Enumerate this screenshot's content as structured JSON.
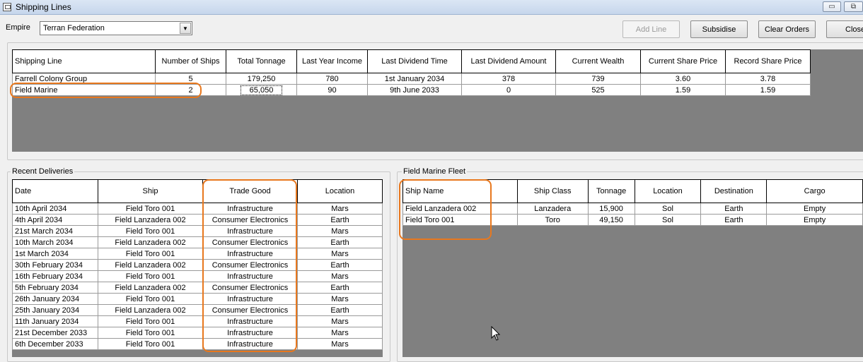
{
  "window": {
    "title": "Shipping Lines",
    "min_glyph": "▭",
    "restore_glyph": "⧉"
  },
  "empire": {
    "label": "Empire",
    "selected": "Terran Federation"
  },
  "toolbar": {
    "add_line": "Add Line",
    "subsidise": "Subsidise",
    "clear_orders": "Clear Orders",
    "close": "Close"
  },
  "shipping_lines": {
    "columns": [
      "Shipping Line",
      "Number of Ships",
      "Total Tonnage",
      "Last Year Income",
      "Last Dividend Time",
      "Last Dividend Amount",
      "Current Wealth",
      "Current Share Price",
      "Record Share Price"
    ],
    "rows": [
      [
        "Farrell Colony Group",
        "5",
        "179,250",
        "780",
        "1st January 2034",
        "378",
        "739",
        "3.60",
        "3.78"
      ],
      [
        "Field Marine",
        "2",
        "65,050",
        "90",
        "9th June 2033",
        "0",
        "525",
        "1.59",
        "1.59"
      ]
    ]
  },
  "deliveries": {
    "title": "Recent Deliveries",
    "columns": [
      "Date",
      "Ship",
      "Trade Good",
      "Location"
    ],
    "rows": [
      [
        "10th April 2034",
        "Field Toro 001",
        "Infrastructure",
        "Mars"
      ],
      [
        "4th April 2034",
        "Field Lanzadera 002",
        "Consumer Electronics",
        "Earth"
      ],
      [
        "21st March 2034",
        "Field Toro 001",
        "Infrastructure",
        "Mars"
      ],
      [
        "10th March 2034",
        "Field Lanzadera 002",
        "Consumer Electronics",
        "Earth"
      ],
      [
        "1st March 2034",
        "Field Toro 001",
        "Infrastructure",
        "Mars"
      ],
      [
        "30th February 2034",
        "Field Lanzadera 002",
        "Consumer Electronics",
        "Earth"
      ],
      [
        "16th February 2034",
        "Field Toro 001",
        "Infrastructure",
        "Mars"
      ],
      [
        "5th February 2034",
        "Field Lanzadera 002",
        "Consumer Electronics",
        "Earth"
      ],
      [
        "26th January 2034",
        "Field Toro 001",
        "Infrastructure",
        "Mars"
      ],
      [
        "25th January 2034",
        "Field Lanzadera 002",
        "Consumer Electronics",
        "Earth"
      ],
      [
        "11th January 2034",
        "Field Toro 001",
        "Infrastructure",
        "Mars"
      ],
      [
        "21st December 2033",
        "Field Toro 001",
        "Infrastructure",
        "Mars"
      ],
      [
        "6th December 2033",
        "Field Toro 001",
        "Infrastructure",
        "Mars"
      ]
    ]
  },
  "fleet": {
    "title": "Field Marine Fleet",
    "columns": [
      "Ship Name",
      "Ship Class",
      "Tonnage",
      "Location",
      "Destination",
      "Cargo"
    ],
    "rows": [
      [
        "Field Lanzadera 002",
        "Lanzadera",
        "15,900",
        "Sol",
        "Earth",
        "Empty"
      ],
      [
        "Field Toro 001",
        "Toro",
        "49,150",
        "Sol",
        "Earth",
        "Empty"
      ]
    ]
  },
  "colors": {
    "highlight": "#e8781e",
    "grid_background": "#808080"
  }
}
